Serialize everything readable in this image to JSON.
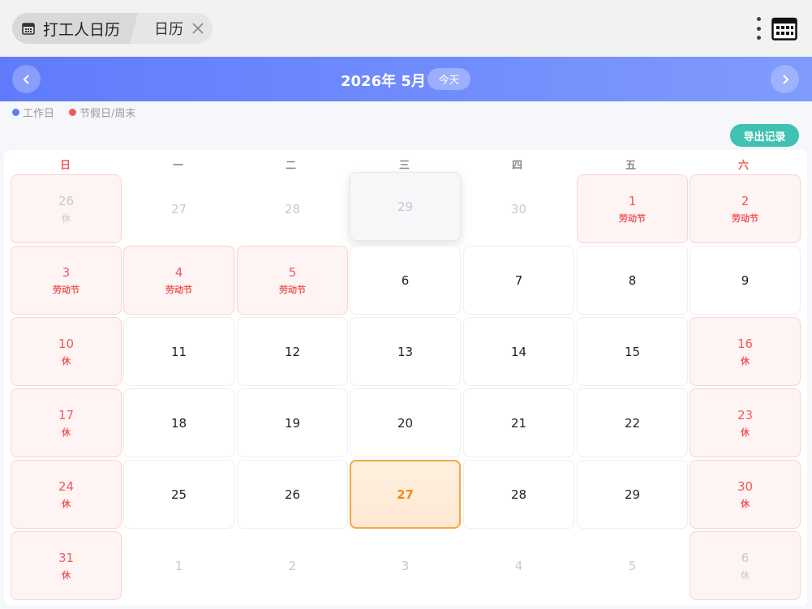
{
  "tabbar": {
    "app_tab_label": "打工人日历",
    "sub_tab_label": "日历",
    "app_tab_icon": "calendar-icon",
    "close_icon": "close-icon",
    "more_icon": "more-vertical-icon",
    "app_icon": "calendar-grid-icon"
  },
  "header": {
    "title": "2026年 5月",
    "today_label": "今天",
    "prev_icon": "chevron-left-icon",
    "next_icon": "chevron-right-icon"
  },
  "legend": [
    {
      "label": "工作日",
      "color": "#5f7bfb"
    },
    {
      "label": "节假日/周末",
      "color": "#ef5b5b"
    }
  ],
  "export_label": "导出记录",
  "weekdays": [
    "日",
    "一",
    "二",
    "三",
    "四",
    "五",
    "六"
  ],
  "weeks": [
    [
      {
        "day": "26",
        "sub": "休",
        "type": "holiday",
        "other": true
      },
      {
        "day": "27",
        "sub": "",
        "type": "work",
        "other": true
      },
      {
        "day": "28",
        "sub": "",
        "type": "work",
        "other": true
      },
      {
        "day": "29",
        "sub": "",
        "type": "work",
        "other": true,
        "hover": true
      },
      {
        "day": "30",
        "sub": "",
        "type": "work",
        "other": true
      },
      {
        "day": "1",
        "sub": "劳动节",
        "type": "holiday",
        "other": false
      },
      {
        "day": "2",
        "sub": "劳动节",
        "type": "holiday",
        "other": false
      }
    ],
    [
      {
        "day": "3",
        "sub": "劳动节",
        "type": "holiday",
        "other": false
      },
      {
        "day": "4",
        "sub": "劳动节",
        "type": "holiday",
        "other": false
      },
      {
        "day": "5",
        "sub": "劳动节",
        "type": "holiday",
        "other": false
      },
      {
        "day": "6",
        "sub": "",
        "type": "work",
        "other": false
      },
      {
        "day": "7",
        "sub": "",
        "type": "work",
        "other": false
      },
      {
        "day": "8",
        "sub": "",
        "type": "work",
        "other": false
      },
      {
        "day": "9",
        "sub": "",
        "type": "work",
        "other": false
      }
    ],
    [
      {
        "day": "10",
        "sub": "休",
        "type": "holiday",
        "other": false
      },
      {
        "day": "11",
        "sub": "",
        "type": "work",
        "other": false
      },
      {
        "day": "12",
        "sub": "",
        "type": "work",
        "other": false
      },
      {
        "day": "13",
        "sub": "",
        "type": "work",
        "other": false
      },
      {
        "day": "14",
        "sub": "",
        "type": "work",
        "other": false
      },
      {
        "day": "15",
        "sub": "",
        "type": "work",
        "other": false
      },
      {
        "day": "16",
        "sub": "休",
        "type": "holiday",
        "other": false
      }
    ],
    [
      {
        "day": "17",
        "sub": "休",
        "type": "holiday",
        "other": false
      },
      {
        "day": "18",
        "sub": "",
        "type": "work",
        "other": false
      },
      {
        "day": "19",
        "sub": "",
        "type": "work",
        "other": false
      },
      {
        "day": "20",
        "sub": "",
        "type": "work",
        "other": false
      },
      {
        "day": "21",
        "sub": "",
        "type": "work",
        "other": false
      },
      {
        "day": "22",
        "sub": "",
        "type": "work",
        "other": false
      },
      {
        "day": "23",
        "sub": "休",
        "type": "holiday",
        "other": false
      }
    ],
    [
      {
        "day": "24",
        "sub": "休",
        "type": "holiday",
        "other": false
      },
      {
        "day": "25",
        "sub": "",
        "type": "work",
        "other": false
      },
      {
        "day": "26",
        "sub": "",
        "type": "work",
        "other": false
      },
      {
        "day": "27",
        "sub": "",
        "type": "work",
        "other": false,
        "today": true
      },
      {
        "day": "28",
        "sub": "",
        "type": "work",
        "other": false
      },
      {
        "day": "29",
        "sub": "",
        "type": "work",
        "other": false
      },
      {
        "day": "30",
        "sub": "休",
        "type": "holiday",
        "other": false
      }
    ],
    [
      {
        "day": "31",
        "sub": "休",
        "type": "holiday",
        "other": false
      },
      {
        "day": "1",
        "sub": "",
        "type": "work",
        "other": true
      },
      {
        "day": "2",
        "sub": "",
        "type": "work",
        "other": true
      },
      {
        "day": "3",
        "sub": "",
        "type": "work",
        "other": true
      },
      {
        "day": "4",
        "sub": "",
        "type": "work",
        "other": true
      },
      {
        "day": "5",
        "sub": "",
        "type": "work",
        "other": true
      },
      {
        "day": "6",
        "sub": "休",
        "type": "holiday",
        "other": true
      }
    ]
  ]
}
